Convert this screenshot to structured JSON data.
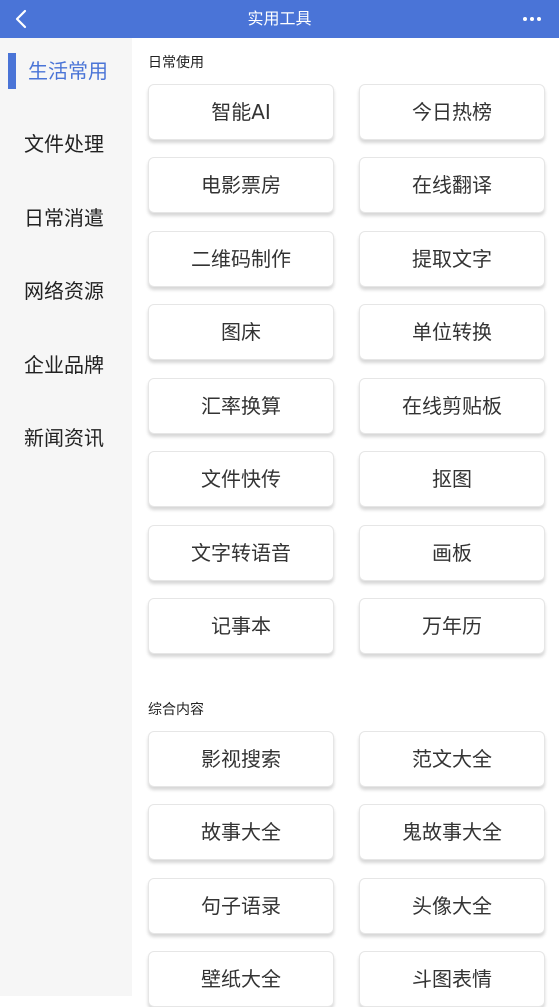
{
  "header": {
    "title": "实用工具"
  },
  "sidebar": {
    "items": [
      {
        "label": "生活常用"
      },
      {
        "label": "文件处理"
      },
      {
        "label": "日常消遣"
      },
      {
        "label": "网络资源"
      },
      {
        "label": "企业品牌"
      },
      {
        "label": "新闻资讯"
      }
    ]
  },
  "sections": [
    {
      "title": "日常使用",
      "items": [
        "智能AI",
        "今日热榜",
        "电影票房",
        "在线翻译",
        "二维码制作",
        "提取文字",
        "图床",
        "单位转换",
        "汇率换算",
        "在线剪贴板",
        "文件快传",
        "抠图",
        "文字转语音",
        "画板",
        "记事本",
        "万年历"
      ]
    },
    {
      "title": "综合内容",
      "items": [
        "影视搜索",
        "范文大全",
        "故事大全",
        "鬼故事大全",
        "句子语录",
        "头像大全",
        "壁纸大全",
        "斗图表情"
      ]
    }
  ],
  "colors": {
    "accent": "#4a74d7",
    "sidebar_bg": "#f6f6f6"
  },
  "icons": {
    "back": "chevron-left-icon",
    "more": "more-dots-icon"
  }
}
